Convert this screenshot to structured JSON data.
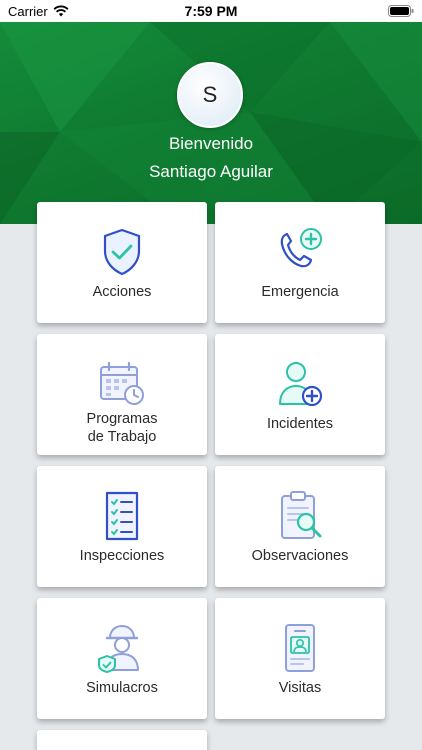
{
  "status_bar": {
    "carrier": "Carrier",
    "time": "7:59 PM"
  },
  "header": {
    "avatar_initial": "S",
    "welcome": "Bienvenido",
    "user_name": "Santiago Aguilar",
    "color": "#0f7a30"
  },
  "menu": {
    "items": [
      {
        "label": "Acciones",
        "icon": "shield-check-icon"
      },
      {
        "label": "Emergencia",
        "icon": "phone-medical-icon"
      },
      {
        "label": "Programas\nde Trabajo",
        "icon": "calendar-clock-icon"
      },
      {
        "label": "Incidentes",
        "icon": "person-plus-icon"
      },
      {
        "label": "Inspecciones",
        "icon": "checklist-icon"
      },
      {
        "label": "Observaciones",
        "icon": "clipboard-search-icon"
      },
      {
        "label": "Simulacros",
        "icon": "worker-helmet-icon"
      },
      {
        "label": "Visitas",
        "icon": "id-badge-icon"
      }
    ]
  }
}
